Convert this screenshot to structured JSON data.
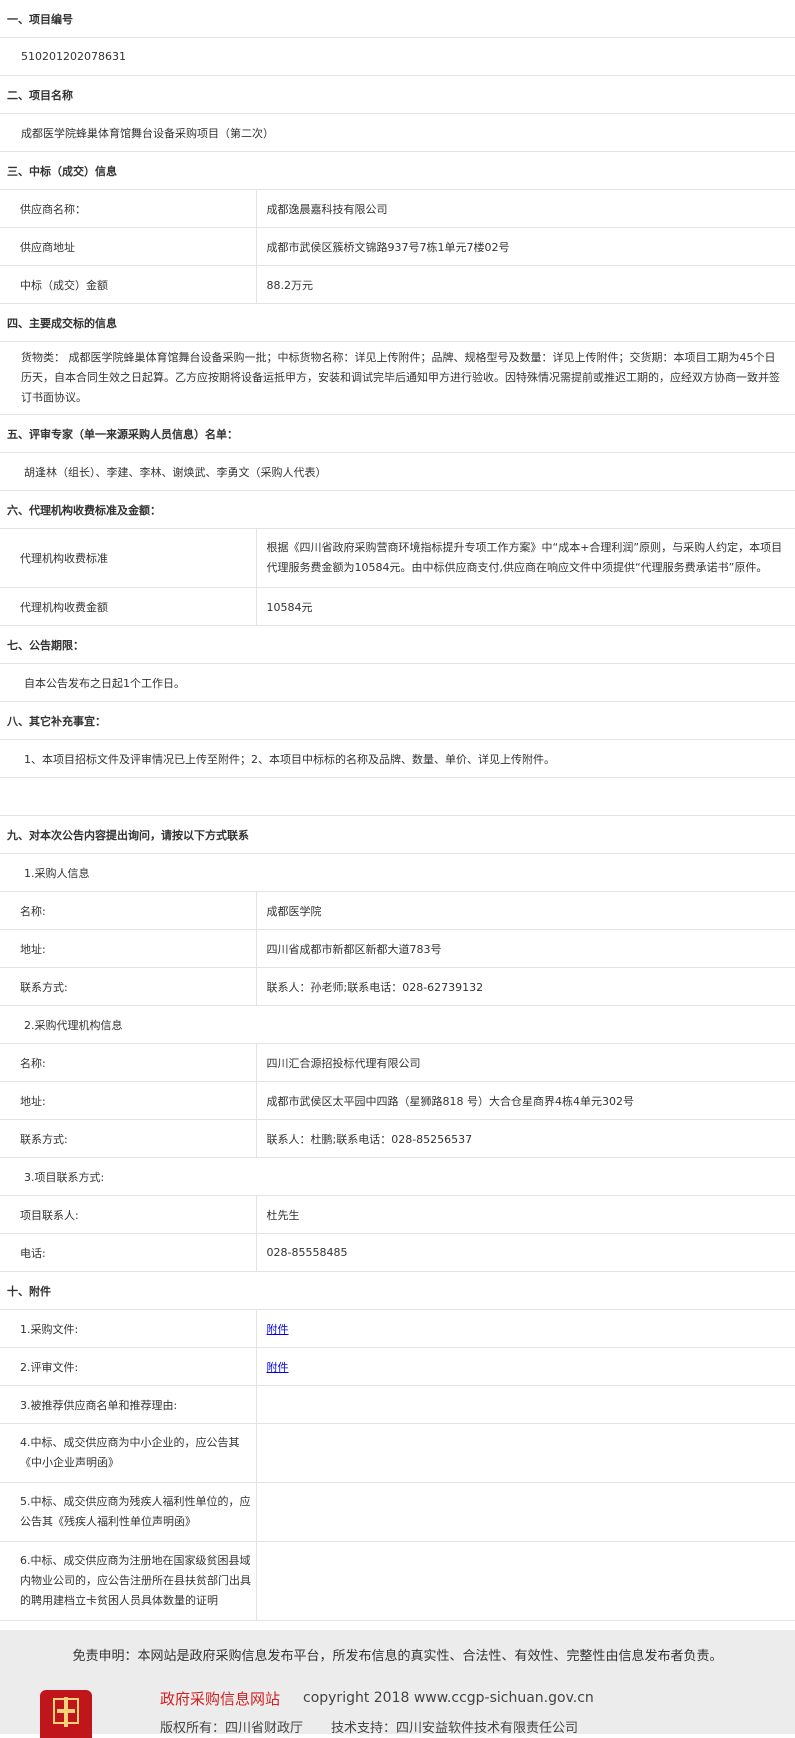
{
  "s1": {
    "title": "一、项目编号",
    "value": "510201202078631"
  },
  "s2": {
    "title": "二、项目名称",
    "value": "成都医学院蜂巢体育馆舞台设备采购项目（第二次）"
  },
  "s3": {
    "title": "三、中标（成交）信息",
    "rows": [
      {
        "label": "供应商名称：",
        "value": "成都逸晨嘉科技有限公司"
      },
      {
        "label": "供应商地址",
        "value": "成都市武侯区簇桥文锦路937号7栋1单元7楼02号"
      },
      {
        "label": "中标（成交）金额",
        "value": "88.2万元"
      }
    ]
  },
  "s4": {
    "title": "四、主要成交标的信息",
    "text": "货物类： 成都医学院蜂巢体育馆舞台设备采购一批；中标货物名称：详见上传附件；品牌、规格型号及数量：详见上传附件；交货期：本项目工期为45个日历天，自本合同生效之日起算。乙方应按期将设备运抵甲方，安装和调试完毕后通知甲方进行验收。因特殊情况需提前或推迟工期的，应经双方协商一致并签订书面协议。"
  },
  "s5": {
    "title": "五、评审专家（单一来源采购人员信息）名单：",
    "value": "胡逢林（组长）、李建、李林、谢焕武、李勇文（采购人代表）"
  },
  "s6": {
    "title": "六、代理机构收费标准及金额：",
    "rows": [
      {
        "label": "代理机构收费标准",
        "value": "根据《四川省政府采购营商环境指标提升专项工作方案》中“成本+合理利润”原则，与采购人约定，本项目代理服务费金额为10584元。由中标供应商支付,供应商在响应文件中须提供“代理服务费承诺书”原件。"
      },
      {
        "label": "代理机构收费金额",
        "value": "10584元"
      }
    ]
  },
  "s7": {
    "title": "七、公告期限：",
    "value": "自本公告发布之日起1个工作日。"
  },
  "s8": {
    "title": "八、其它补充事宜：",
    "value": "1、本项目招标文件及评审情况已上传至附件；2、本项目中标标的名称及品牌、数量、单价、详见上传附件。"
  },
  "s9": {
    "title": "九、对本次公告内容提出询问，请按以下方式联系",
    "purchaser": {
      "heading": "1.采购人信息",
      "rows": [
        {
          "label": "名称:",
          "value": "成都医学院"
        },
        {
          "label": "地址:",
          "value": "四川省成都市新都区新都大道783号"
        },
        {
          "label": "联系方式:",
          "value": "联系人：孙老师;联系电话：028-62739132"
        }
      ]
    },
    "agency": {
      "heading": "2.采购代理机构信息",
      "rows": [
        {
          "label": "名称:",
          "value": "四川汇合源招投标代理有限公司"
        },
        {
          "label": "地址:",
          "value": "成都市武侯区太平园中四路（星狮路818 号）大合仓星商界4栋4单元302号"
        },
        {
          "label": "联系方式:",
          "value": "联系人：杜鹏;联系电话：028-85256537"
        }
      ]
    },
    "project": {
      "heading": "3.项目联系方式:",
      "rows": [
        {
          "label": "项目联系人:",
          "value": "杜先生"
        },
        {
          "label": "电话:",
          "value": "028-85558485"
        }
      ]
    }
  },
  "s10": {
    "title": "十、附件",
    "rows": [
      {
        "label": "1.采购文件:",
        "link": "附件"
      },
      {
        "label": "2.评审文件:",
        "link": "附件"
      },
      {
        "label": "3.被推荐供应商名单和推荐理由:",
        "link": ""
      },
      {
        "label": "4.中标、成交供应商为中小企业的，应公告其《中小企业声明函》",
        "link": ""
      },
      {
        "label": "5.中标、成交供应商为残疾人福利性单位的，应公告其《残疾人福利性单位声明函》",
        "link": ""
      },
      {
        "label": "6.中标、成交供应商为注册地在国家级贫困县域内物业公司的，应公告注册所在县扶贫部门出具的聘用建档立卡贫困人员具体数量的证明",
        "link": ""
      }
    ]
  },
  "footer": {
    "disclaimer": "免责申明：本网站是政府采购信息发布平台，所发布信息的真实性、合法性、有效性、完整性由信息发布者负责。",
    "site_name": "政府采购信息网站",
    "copyright": "copyright 2018 www.ccgp-sichuan.gov.cn",
    "owner": "版权所有：四川省财政厅",
    "support": "技术支持：四川安益软件技术有限责任公司",
    "logo_icon": "emblem-icon"
  },
  "colors": {
    "link": "#0000ee",
    "site_name": "#d4201f",
    "border": "#e3e3e3",
    "footer_bg": "#ececec"
  }
}
